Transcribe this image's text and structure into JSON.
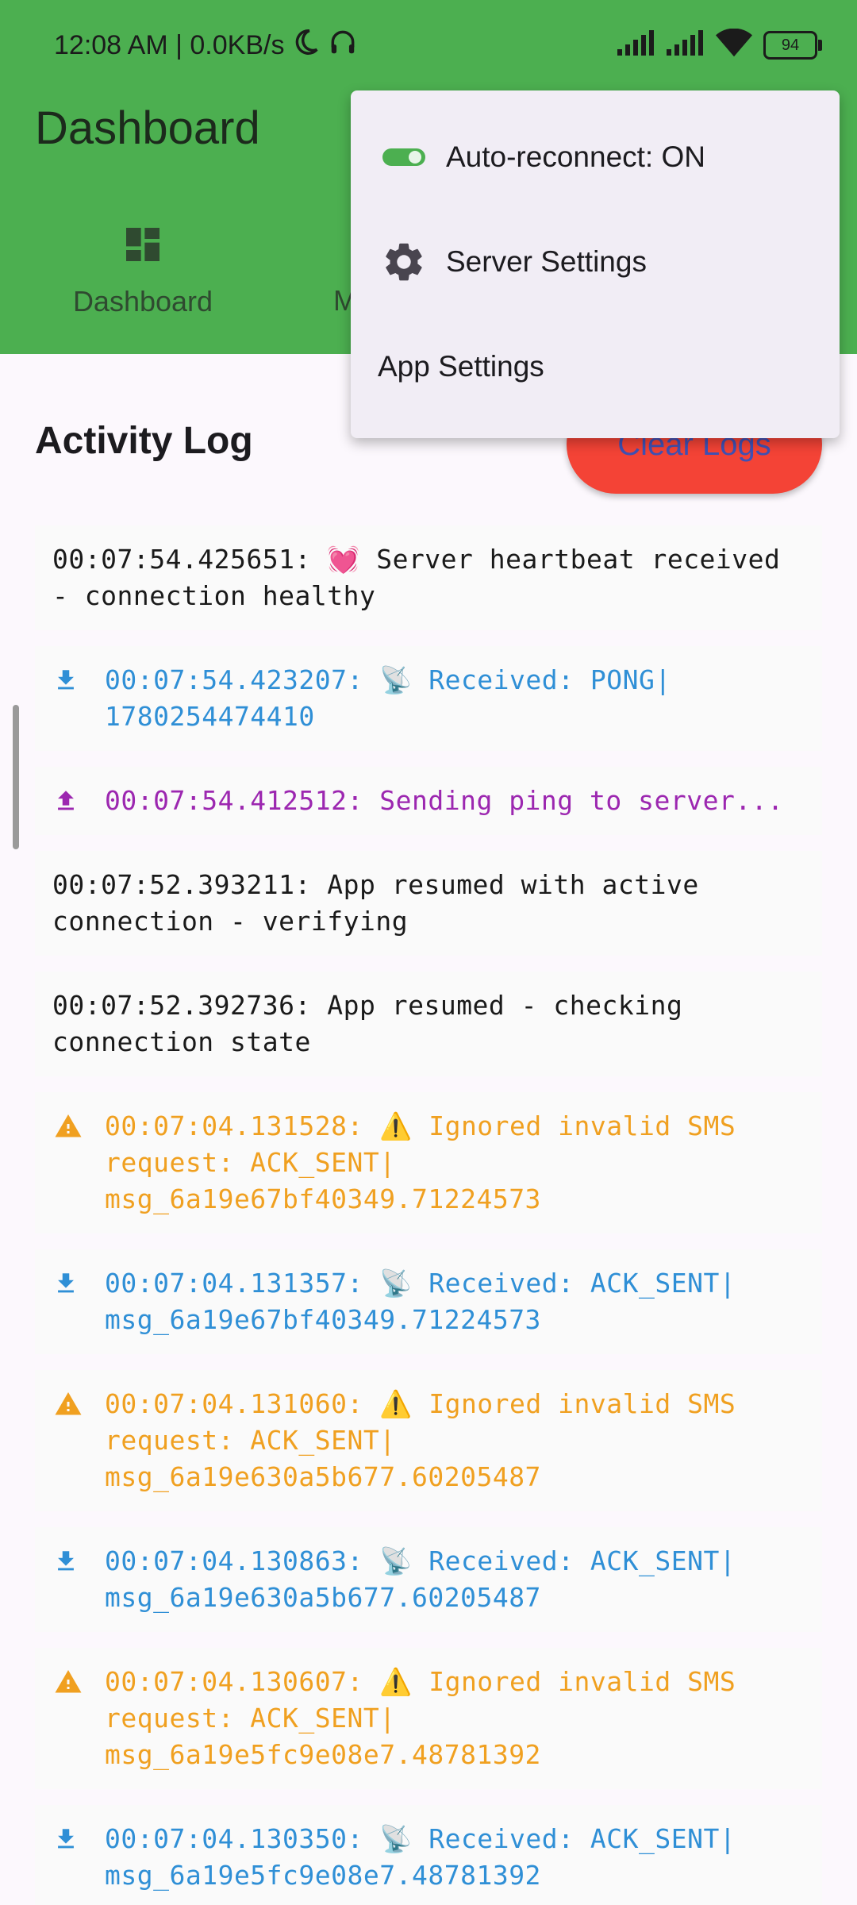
{
  "status_bar": {
    "time_and_speed": "12:08 AM | 0.0KB/s",
    "battery": "94"
  },
  "app_bar": {
    "title": "Dashboard",
    "tabs": [
      {
        "label": "Dashboard",
        "icon": "dashboard-icon"
      },
      {
        "label": "M"
      }
    ],
    "background_color": "#4CAF50"
  },
  "overflow_menu": {
    "items": [
      {
        "label": "Auto-reconnect: ON",
        "icon": "toggle-on-icon"
      },
      {
        "label": "Server Settings",
        "icon": "gear-icon"
      },
      {
        "label": "App Settings"
      }
    ]
  },
  "activity": {
    "title": "Activity Log",
    "clear_button": "Clear Logs",
    "logs": [
      {
        "type": "default",
        "icon": "",
        "text": "00:07:54.425651: 💓 Server heartbeat received - connection healthy"
      },
      {
        "type": "info",
        "icon": "download-icon",
        "text": "00:07:54.423207: 📡 Received: PONG|\n1780254474410"
      },
      {
        "type": "send",
        "icon": "upload-icon",
        "text": "00:07:54.412512: Sending ping to server..."
      },
      {
        "type": "default",
        "icon": "",
        "text": "00:07:52.393211: App resumed with active connection - verifying"
      },
      {
        "type": "default",
        "icon": "",
        "text": "00:07:52.392736: App resumed - checking connection state"
      },
      {
        "type": "warn",
        "icon": "warning-icon",
        "text": "00:07:04.131528: ⚠️ Ignored invalid SMS\nrequest: ACK_SENT|\nmsg_6a19e67bf40349.71224573"
      },
      {
        "type": "info",
        "icon": "download-icon",
        "text": "00:07:04.131357: 📡 Received: ACK_SENT|\nmsg_6a19e67bf40349.71224573"
      },
      {
        "type": "warn",
        "icon": "warning-icon",
        "text": "00:07:04.131060: ⚠️ Ignored invalid SMS\nrequest: ACK_SENT|\nmsg_6a19e630a5b677.60205487"
      },
      {
        "type": "info",
        "icon": "download-icon",
        "text": "00:07:04.130863: 📡 Received: ACK_SENT|\nmsg_6a19e630a5b677.60205487"
      },
      {
        "type": "warn",
        "icon": "warning-icon",
        "text": "00:07:04.130607: ⚠️ Ignored invalid SMS\nrequest: ACK_SENT|\nmsg_6a19e5fc9e08e7.48781392"
      },
      {
        "type": "info",
        "icon": "download-icon",
        "text": "00:07:04.130350: 📡 Received: ACK_SENT|\nmsg_6a19e5fc9e08e7.48781392"
      }
    ]
  }
}
